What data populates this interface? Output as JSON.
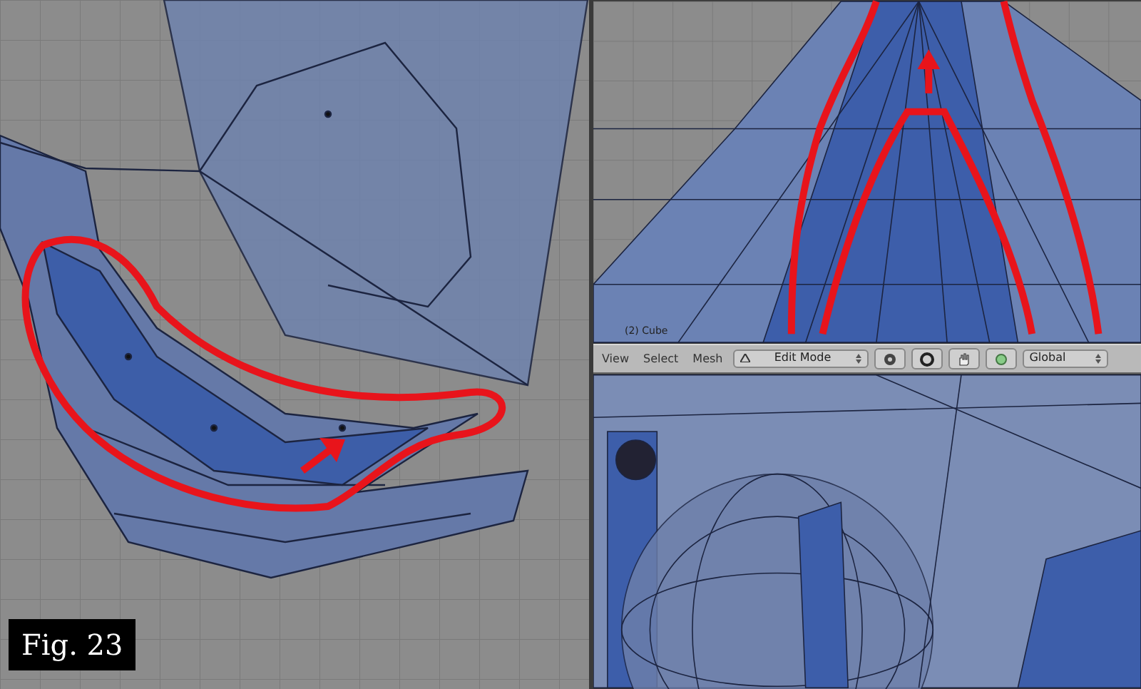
{
  "top_right_view": {
    "object_label": "(2) Cube"
  },
  "header": {
    "menus": [
      "View",
      "Select",
      "Mesh"
    ],
    "mode": "Edit Mode",
    "orientation": "Global"
  },
  "figure_label": "Fig. 23"
}
